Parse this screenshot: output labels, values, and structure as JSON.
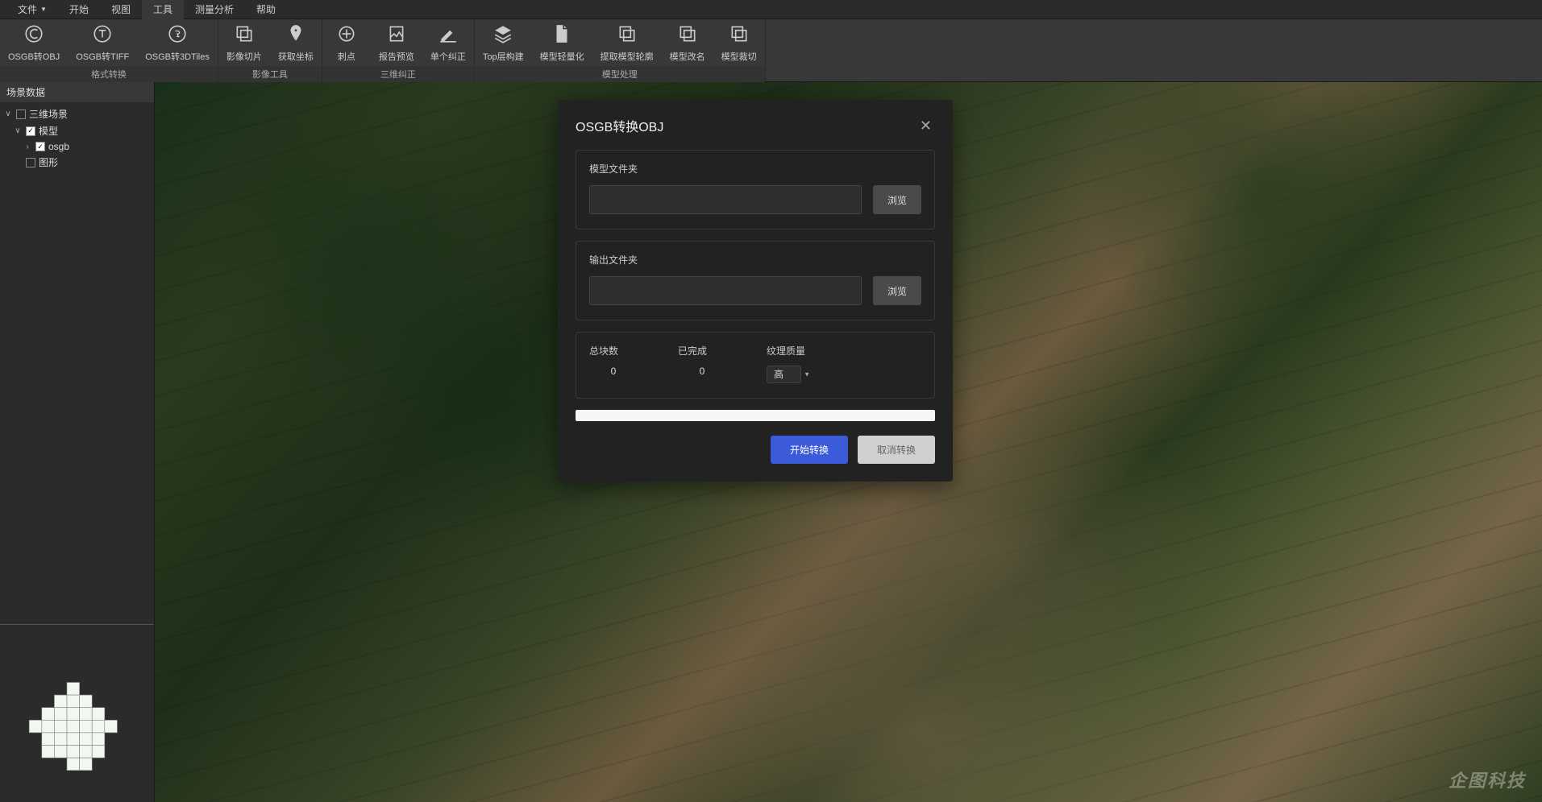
{
  "menubar": {
    "file": "文件",
    "start": "开始",
    "view": "视图",
    "tools": "工具",
    "measure": "测量分析",
    "help": "帮助"
  },
  "ribbon": {
    "groups": [
      {
        "label": "格式转换",
        "items": [
          {
            "icon": "convert-c-icon",
            "label": "OSGB转OBJ"
          },
          {
            "icon": "convert-t-icon",
            "label": "OSGB转TIFF"
          },
          {
            "icon": "convert-3d-icon",
            "label": "OSGB转3DTiles"
          }
        ]
      },
      {
        "label": "影像工具",
        "items": [
          {
            "icon": "image-slice-icon",
            "label": "影像切片"
          },
          {
            "icon": "get-coord-icon",
            "label": "获取坐标"
          }
        ]
      },
      {
        "label": "三维纠正",
        "items": [
          {
            "icon": "puncture-icon",
            "label": "刺点"
          },
          {
            "icon": "report-preview-icon",
            "label": "报告预览"
          },
          {
            "icon": "single-correct-icon",
            "label": "单个纠正"
          }
        ]
      },
      {
        "label": "模型处理",
        "items": [
          {
            "icon": "top-layer-icon",
            "label": "Top层构建"
          },
          {
            "icon": "lightweight-icon",
            "label": "模型轻量化"
          },
          {
            "icon": "extract-outline-icon",
            "label": "提取模型轮廓"
          },
          {
            "icon": "rename-icon",
            "label": "模型改名"
          },
          {
            "icon": "crop-icon",
            "label": "模型裁切"
          }
        ]
      }
    ]
  },
  "sidebar": {
    "header": "场景数据",
    "tree": {
      "root": "三维场景",
      "model": "模型",
      "osgb": "osgb",
      "graphic": "图形"
    }
  },
  "modal": {
    "title": "OSGB转换OBJ",
    "model_folder_label": "模型文件夹",
    "output_folder_label": "输出文件夹",
    "browse": "浏览",
    "total_blocks_label": "总块数",
    "total_blocks_value": "0",
    "completed_label": "已完成",
    "completed_value": "0",
    "texture_quality_label": "纹理质量",
    "texture_quality_value": "高",
    "start_button": "开始转换",
    "cancel_button": "取消转换"
  },
  "watermark": "企图科技"
}
